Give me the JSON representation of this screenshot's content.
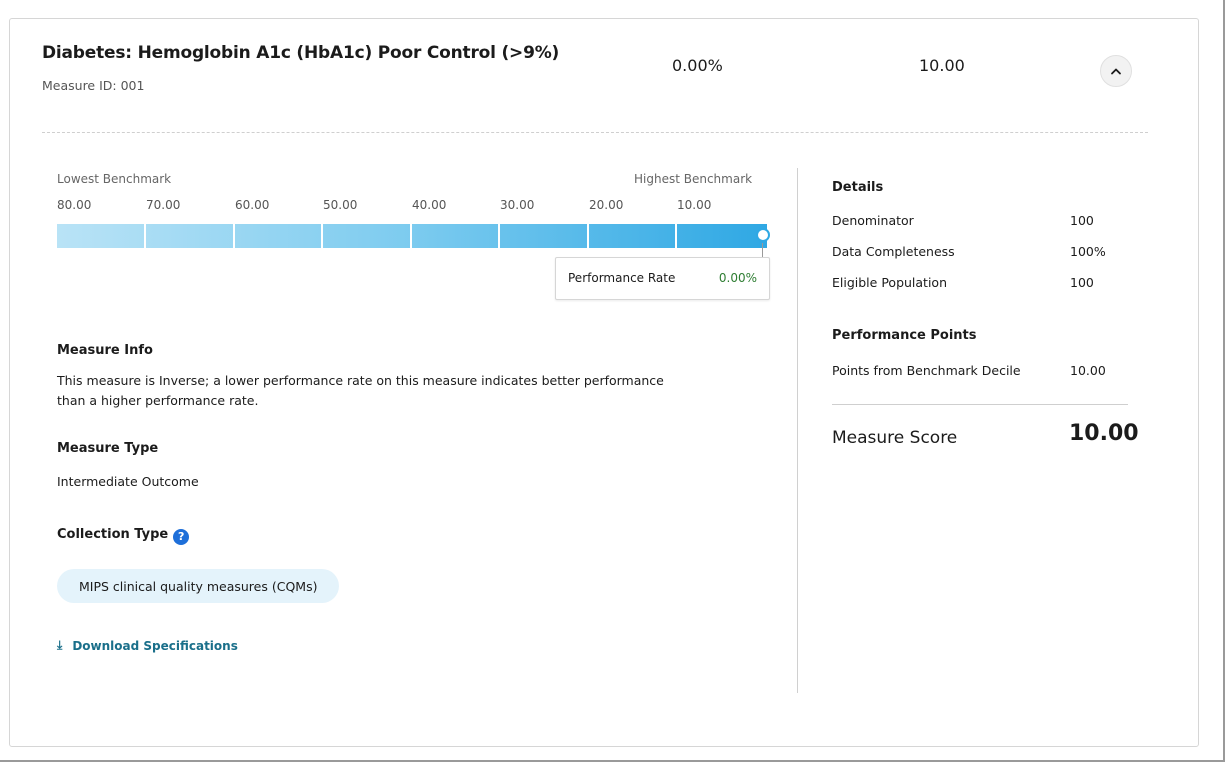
{
  "header": {
    "title": "Diabetes: Hemoglobin A1c (HbA1c) Poor Control (>9%)",
    "measure_id": "Measure ID: 001",
    "performance_rate": "0.00%",
    "score": "10.00",
    "collapse_icon": "chevron-up-icon"
  },
  "benchmark": {
    "lowest_label": "Lowest Benchmark",
    "highest_label": "Highest Benchmark",
    "ticks": [
      "80.00",
      "70.00",
      "60.00",
      "50.00",
      "40.00",
      "30.00",
      "20.00",
      "10.00"
    ],
    "bar_colors": [
      "#b9e3f6",
      "#2fa8e4"
    ],
    "performance_rate_label": "Performance Rate",
    "performance_rate_value": "0.00%",
    "performance_rate_color": "#2e7d32"
  },
  "measure_info": {
    "heading": "Measure Info",
    "text_line1": "This measure is Inverse; a lower performance rate on this measure indicates better performance",
    "text_line2": "than a higher performance rate."
  },
  "measure_type": {
    "heading": "Measure Type",
    "value": "Intermediate Outcome"
  },
  "collection_type": {
    "heading": "Collection Type",
    "help_icon": "question-circle-icon",
    "help_glyph": "?",
    "chip": "MIPS clinical quality measures (CQMs)"
  },
  "download": {
    "icon": "download-icon",
    "glyph": "⤓",
    "label": "Download Specifications"
  },
  "details": {
    "heading": "Details",
    "rows": [
      {
        "label": "Denominator",
        "value": "100"
      },
      {
        "label": "Data Completeness",
        "value": "100%"
      },
      {
        "label": "Eligible Population",
        "value": "100"
      }
    ]
  },
  "performance_points": {
    "heading": "Performance Points",
    "rows": [
      {
        "label": "Points from Benchmark Decile",
        "value": "10.00"
      }
    ]
  },
  "measure_score": {
    "label": "Measure Score",
    "value": "10.00"
  }
}
